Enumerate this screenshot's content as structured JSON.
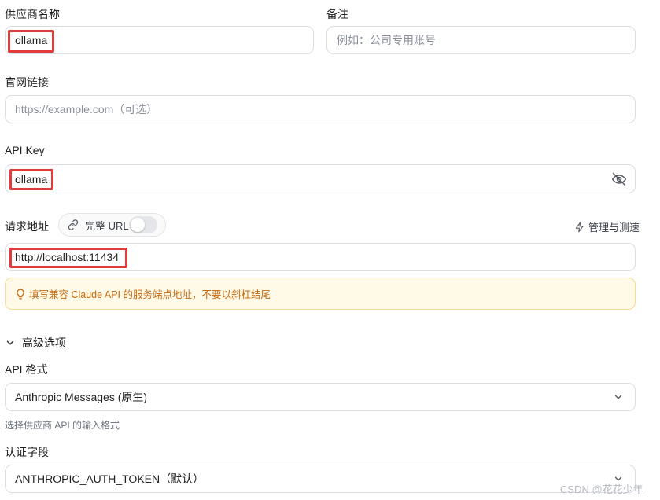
{
  "provider_name": {
    "label": "供应商名称",
    "value": "ollama"
  },
  "notes": {
    "label": "备注",
    "placeholder": "例如：公司专用账号"
  },
  "website": {
    "label": "官网链接",
    "placeholder": "https://example.com（可选）"
  },
  "api_key": {
    "label": "API Key",
    "value": "ollama",
    "visibility_icon": "eye-off-icon"
  },
  "request_url": {
    "label": "请求地址",
    "full_url_toggle_label": "完整 URL",
    "full_url_enabled": false,
    "manage_label": "管理与测速",
    "value": "http://localhost:11434"
  },
  "notice": {
    "icon": "lightbulb-icon",
    "text": "填写兼容 Claude API 的服务端点地址，不要以斜杠结尾"
  },
  "advanced": {
    "toggle_label": "高级选项",
    "expanded": true
  },
  "api_format": {
    "label": "API 格式",
    "selected": "Anthropic Messages (原生)",
    "hint": "选择供应商 API 的输入格式"
  },
  "auth_field": {
    "label": "认证字段",
    "selected": "ANTHROPIC_AUTH_TOKEN（默认）"
  },
  "watermark": "CSDN @花花少年",
  "colors": {
    "highlight": "#e23b3b",
    "notice_bg": "#fff9e8",
    "notice_text": "#c46a12",
    "border": "#dadde2"
  }
}
